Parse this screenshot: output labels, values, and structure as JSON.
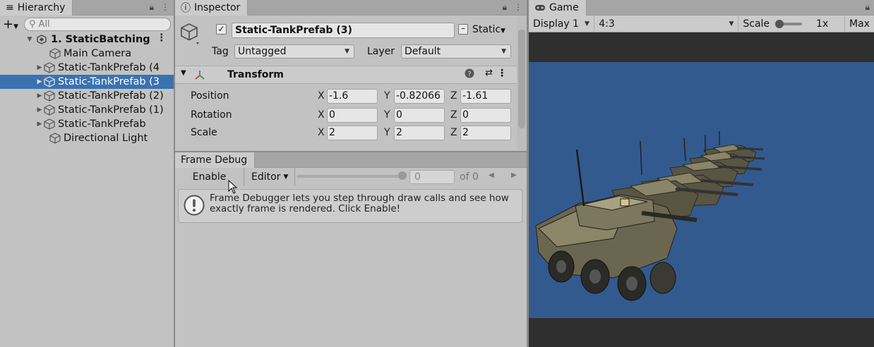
{
  "hierarchy": {
    "tab_label": "Hierarchy",
    "add_label": "+",
    "search_placeholder": "All",
    "scene": "1. StaticBatching",
    "items": [
      {
        "label": "Main Camera",
        "expandable": false,
        "selected": false
      },
      {
        "label": "Static-TankPrefab (4",
        "expandable": true,
        "selected": false
      },
      {
        "label": "Static-TankPrefab (3",
        "expandable": true,
        "selected": true
      },
      {
        "label": "Static-TankPrefab (2)",
        "expandable": true,
        "selected": false
      },
      {
        "label": "Static-TankPrefab (1)",
        "expandable": true,
        "selected": false
      },
      {
        "label": "Static-TankPrefab",
        "expandable": true,
        "selected": false
      },
      {
        "label": "Directional Light",
        "expandable": false,
        "selected": false
      }
    ]
  },
  "inspector": {
    "tab_label": "Inspector",
    "object_name": "Static-TankPrefab (3)",
    "static_label": "Static",
    "tag_label": "Tag",
    "tag_value": "Untagged",
    "layer_label": "Layer",
    "layer_value": "Default",
    "component": "Transform",
    "fields": [
      {
        "name": "Position",
        "x": "-1.6",
        "y": "-0.82066",
        "z": "-1.61"
      },
      {
        "name": "Rotation",
        "x": "0",
        "y": "0",
        "z": "0"
      },
      {
        "name": "Scale",
        "x": "2",
        "y": "2",
        "z": "2"
      }
    ],
    "axis": {
      "x": "X",
      "y": "Y",
      "z": "Z"
    }
  },
  "frame_debug": {
    "tab_label": "Frame Debug",
    "enable_label": "Enable",
    "editor_label": "Editor",
    "frame_value": "0",
    "of_label": "of 0",
    "help_text": "Frame Debugger lets you step through draw calls and see how exactly frame is rendered. Click Enable!"
  },
  "game": {
    "tab_label": "Game",
    "display": "Display 1",
    "aspect": "4:3",
    "scale_label": "Scale",
    "scale_value": "1x",
    "maximize": "Max"
  },
  "colors": {
    "selection": "#3a72b0",
    "viewport_bg": "#335a8e",
    "panel_bg": "#c2c2c2"
  }
}
